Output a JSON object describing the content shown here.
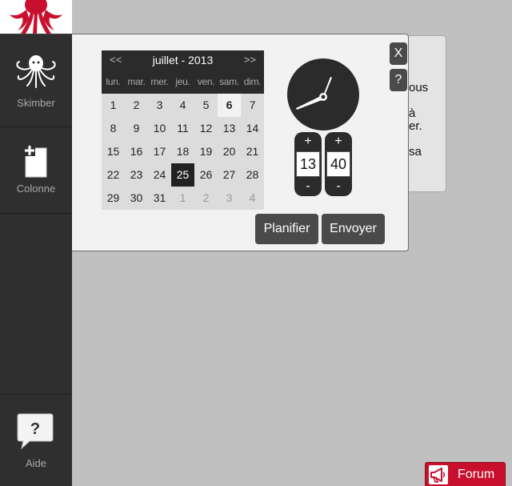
{
  "sidebar": {
    "items": [
      {
        "label": "Skimber",
        "icon": "octopus-icon"
      },
      {
        "label": "Colonne",
        "icon": "add-column-icon"
      },
      {
        "label": "Aide",
        "icon": "help-bubble-icon"
      }
    ]
  },
  "background_panel": {
    "lines": [
      "ous",
      "à",
      "er.",
      "sa"
    ]
  },
  "dialog": {
    "close_label": "X",
    "help_label": "?",
    "calendar": {
      "prev_label": "<<",
      "next_label": ">>",
      "title": "juillet - 2013",
      "weekdays": [
        "lun.",
        "mar.",
        "mer.",
        "jeu.",
        "ven.",
        "sam.",
        "dim."
      ],
      "weeks": [
        [
          "1",
          "2",
          "3",
          "4",
          "5",
          "6",
          "7"
        ],
        [
          "8",
          "9",
          "10",
          "11",
          "12",
          "13",
          "14"
        ],
        [
          "15",
          "16",
          "17",
          "18",
          "19",
          "20",
          "21"
        ],
        [
          "22",
          "23",
          "24",
          "25",
          "26",
          "27",
          "28"
        ],
        [
          "29",
          "30",
          "31",
          "1",
          "2",
          "3",
          "4"
        ]
      ],
      "today": "6",
      "selected": "25"
    },
    "time": {
      "plus_label": "+",
      "minus_label": "-",
      "hour": "13",
      "minute": "40"
    },
    "schedule_label": "Planifier",
    "send_label": "Envoyer"
  },
  "forum": {
    "label": "Forum",
    "icon": "megaphone-icon"
  },
  "colors": {
    "sidebar": "#2f2f2f",
    "dialog_dark": "#2b2b2b",
    "button": "#4a4a4a",
    "forum": "#c8102e",
    "logo_octopus": "#c8102e"
  }
}
